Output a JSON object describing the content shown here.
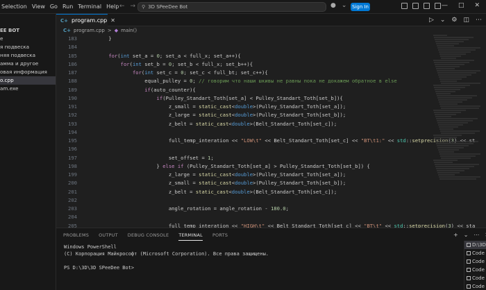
{
  "menu": [
    "Selection",
    "View",
    "Go",
    "Run",
    "Terminal",
    "Help"
  ],
  "command_center": {
    "text": "3D SPeeDee Bot"
  },
  "signin_label": "Sign In",
  "sidebar": {
    "root": "EE BOT",
    "items": [
      {
        "label": "e",
        "active": false
      },
      {
        "label": "я подвеска",
        "active": false
      },
      {
        "label": "няя подвеска",
        "active": false
      },
      {
        "label": "амма и другое",
        "active": false
      },
      {
        "label": "овая информация",
        "active": false
      },
      {
        "label": "o.cpp",
        "active": true
      },
      {
        "label": "am.exe",
        "active": false
      }
    ]
  },
  "editor": {
    "tab_label": "program.cpp",
    "breadcrumb": {
      "file": "program.cpp",
      "sep": ">",
      "symbol": "main()"
    }
  },
  "code_lines": [
    {
      "n": "183",
      "text": "    }"
    },
    {
      "n": "184",
      "text": ""
    },
    {
      "n": "185",
      "text": "    for(int set_a = 0; set_a < full_x; set_a++){"
    },
    {
      "n": "186",
      "text": "        for(int set_b = 0; set_b < full_x; set_b++){"
    },
    {
      "n": "187",
      "text": "            for(int set_c = 0; set_c < full_bt; set_c++){"
    },
    {
      "n": "188",
      "text": "                equal_pulley = 0; // говорим что наши шкивы не равны пока не докажем обратное в else"
    },
    {
      "n": "189",
      "text": "                if(auto_counter){"
    },
    {
      "n": "190",
      "text": "                    if(Pulley_Standart_Toth[set_a] < Pulley_Standart_Toth[set_b]){"
    },
    {
      "n": "191",
      "text": "                        z_small = static_cast<double>(Pulley_Standart_Toth[set_a]);"
    },
    {
      "n": "192",
      "text": "                        z_large = static_cast<double>(Pulley_Standart_Toth[set_b]);"
    },
    {
      "n": "193",
      "text": "                        z_belt = static_cast<double>(Belt_Standart_Toth[set_c]);"
    },
    {
      "n": "194",
      "text": ""
    },
    {
      "n": "195",
      "text": "                        full_temp_interation << \"LOW\\t\" << Belt_Standart_Toth[set_c] << \"BT\\t1:\" << std::setprecision(3) << st"
    },
    {
      "n": "196",
      "text": ""
    },
    {
      "n": "197",
      "text": "                        set_offset = 1;"
    },
    {
      "n": "198",
      "text": "                    } else if (Pulley_Standart_Toth[set_a] > Pulley_Standart_Toth[set_b]) {"
    },
    {
      "n": "199",
      "text": "                        z_large = static_cast<double>(Pulley_Standart_Toth[set_a]);"
    },
    {
      "n": "200",
      "text": "                        z_small = static_cast<double>(Pulley_Standart_Toth[set_b]);"
    },
    {
      "n": "201",
      "text": "                        z_belt = static_cast<double>(Belt_Standart_Toth[set_c]);"
    },
    {
      "n": "202",
      "text": ""
    },
    {
      "n": "203",
      "text": "                        angle_rotation = angle_rotation - 180.0;"
    },
    {
      "n": "204",
      "text": ""
    },
    {
      "n": "205",
      "text": "                        full_temp_interation << \"HIGH\\t\" << Belt_Standart_Toth[set_c] << \"BT\\t\" << std::setprecision(3) << sta"
    },
    {
      "n": "206",
      "text": ""
    },
    {
      "n": "207",
      "text": "                        set_offset = 2;"
    },
    {
      "n": "208",
      "text": "                    } else if (Pulley_Standart_Toth[set_a] == Pulley_Standart_Toth[set_b]) {"
    }
  ],
  "panel": {
    "tabs": [
      "PROBLEMS",
      "OUTPUT",
      "DEBUG CONSOLE",
      "TERMINAL",
      "PORTS"
    ],
    "active_tab": "TERMINAL",
    "terminal_lines": [
      "Windows PowerShell",
      "(C) Корпорация Майкрософт (Microsoft Corporation). Все права защищены.",
      "",
      "PS D:\\3D\\3D SPeeDee Bot>"
    ],
    "terminal_list": [
      "D:\\3D",
      "Code",
      "Code",
      "Code",
      "Code",
      "Code"
    ]
  }
}
